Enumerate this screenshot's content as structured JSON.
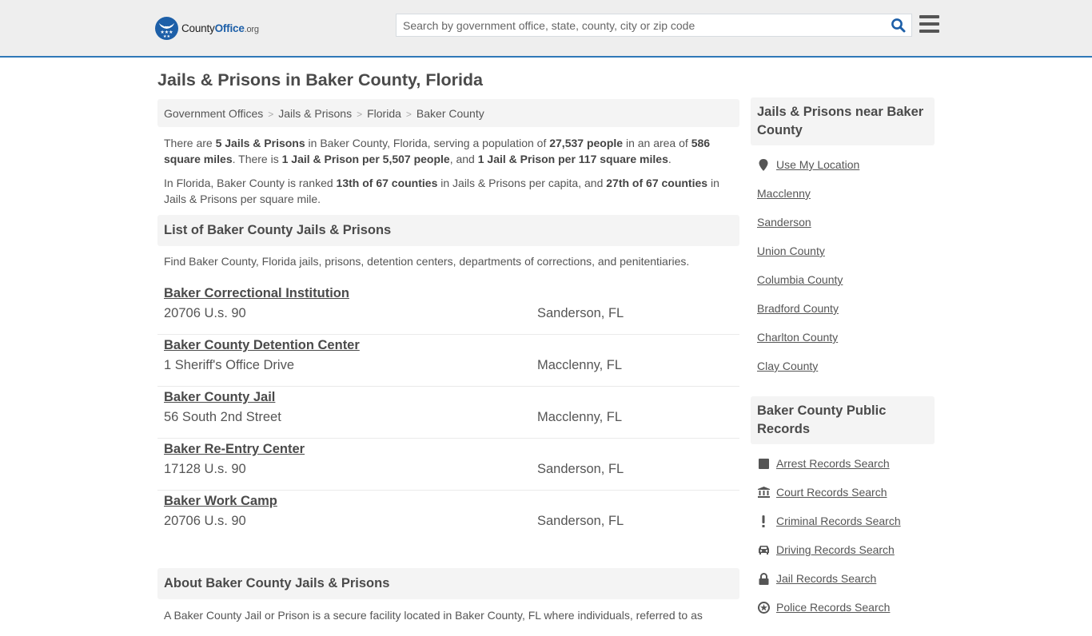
{
  "header": {
    "logo": {
      "part1": "County",
      "part2": "Office",
      "part3": ".org"
    },
    "search_placeholder": "Search by government office, state, county, city or zip code",
    "search_value": ""
  },
  "page_title": "Jails & Prisons in Baker County, Florida",
  "breadcrumb": [
    "Government Offices",
    "Jails & Prisons",
    "Florida",
    "Baker County"
  ],
  "intro": {
    "p1": [
      {
        "t": "There are ",
        "b": false
      },
      {
        "t": "5 Jails & Prisons",
        "b": true
      },
      {
        "t": " in Baker County, Florida, serving a population of ",
        "b": false
      },
      {
        "t": "27,537 people",
        "b": true
      },
      {
        "t": " in an area of ",
        "b": false
      },
      {
        "t": "586 square miles",
        "b": true
      },
      {
        "t": ". There is ",
        "b": false
      },
      {
        "t": "1 Jail & Prison per 5,507 people",
        "b": true
      },
      {
        "t": ", and ",
        "b": false
      },
      {
        "t": "1 Jail & Prison per 117 square miles",
        "b": true
      },
      {
        "t": ".",
        "b": false
      }
    ],
    "p2": [
      {
        "t": "In Florida, Baker County is ranked ",
        "b": false
      },
      {
        "t": "13th of 67 counties",
        "b": true
      },
      {
        "t": " in Jails & Prisons per capita, and ",
        "b": false
      },
      {
        "t": "27th of 67 counties",
        "b": true
      },
      {
        "t": " in Jails & Prisons per square mile.",
        "b": false
      }
    ]
  },
  "list_section": {
    "title": "List of Baker County Jails & Prisons",
    "description": "Find Baker County, Florida jails, prisons, detention centers, departments of corrections, and penitentiaries.",
    "entries": [
      {
        "name": "Baker Correctional Institution",
        "address": "20706 U.s. 90",
        "city": "Sanderson, FL"
      },
      {
        "name": "Baker County Detention Center",
        "address": "1 Sheriff's Office Drive",
        "city": "Macclenny, FL"
      },
      {
        "name": "Baker County Jail",
        "address": "56 South 2nd Street",
        "city": "Macclenny, FL"
      },
      {
        "name": "Baker Re-Entry Center",
        "address": "17128 U.s. 90",
        "city": "Sanderson, FL"
      },
      {
        "name": "Baker Work Camp",
        "address": "20706 U.s. 90",
        "city": "Sanderson, FL"
      }
    ]
  },
  "about_section": {
    "title": "About Baker County Jails & Prisons",
    "text": "A Baker County Jail or Prison is a secure facility located in Baker County, FL where individuals, referred to as"
  },
  "sidebar": {
    "nearby": {
      "title": "Jails & Prisons near Baker County",
      "use_location": {
        "label": "Use My Location",
        "icon": "map-marker-icon"
      },
      "links": [
        "Macclenny",
        "Sanderson",
        "Union County",
        "Columbia County",
        "Bradford County",
        "Charlton County",
        "Clay County"
      ]
    },
    "records": {
      "title": "Baker County Public Records",
      "links": [
        {
          "label": "Arrest Records Search",
          "icon": "square-icon"
        },
        {
          "label": "Court Records Search",
          "icon": "courthouse-icon"
        },
        {
          "label": "Criminal Records Search",
          "icon": "exclamation-icon"
        },
        {
          "label": "Driving Records Search",
          "icon": "car-icon"
        },
        {
          "label": "Jail Records Search",
          "icon": "lock-icon"
        },
        {
          "label": "Police Records Search",
          "icon": "police-icon"
        }
      ]
    }
  },
  "colors": {
    "brand": "#1d5fa8",
    "header_border": "#2f78b7",
    "header_bg": "#eeeeee",
    "panel_bg": "#f4f4f4"
  }
}
